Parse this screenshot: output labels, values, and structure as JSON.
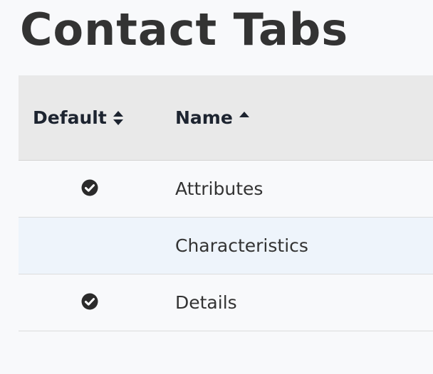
{
  "page": {
    "title": "Contact Tabs"
  },
  "table": {
    "columns": [
      {
        "label": "Default",
        "sort": "unsorted",
        "sort_icon": "sort-icon"
      },
      {
        "label": "Name",
        "sort": "ascending",
        "sort_icon": "sort-up-icon"
      }
    ],
    "rows": [
      {
        "default": true,
        "default_icon": "check-circle-icon",
        "name": "Attributes"
      },
      {
        "default": false,
        "name": "Characteristics"
      },
      {
        "default": true,
        "default_icon": "check-circle-icon",
        "name": "Details"
      }
    ]
  },
  "colors": {
    "header_bg": "#e9e9e9",
    "alt_row_bg": "#eef4fb",
    "page_bg": "#f8f9fb",
    "title_color": "#333333",
    "header_text": "#1d2430"
  }
}
